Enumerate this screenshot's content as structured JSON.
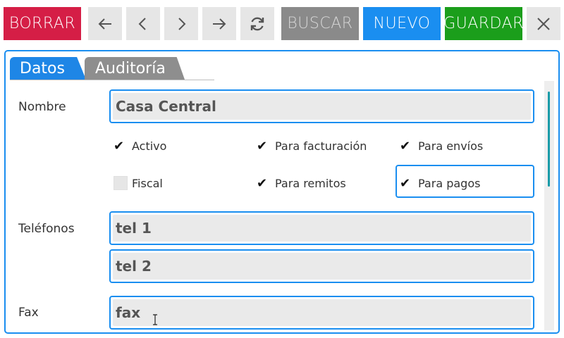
{
  "toolbar": {
    "borrar_label": "BORRAR",
    "buscar_label": "BUSCAR",
    "nuevo_label": "NUEVO",
    "guardar_label": "GUARDAR",
    "icons": [
      "arrow-left-icon",
      "chevron-left-icon",
      "chevron-right-icon",
      "arrow-right-icon",
      "refresh-icon",
      "close-icon"
    ],
    "colors": {
      "borrar": "#d51e46",
      "buscar": "#8a8a8a",
      "nuevo": "#1a8ef0",
      "guardar": "#1b9e1b"
    }
  },
  "tabs": [
    {
      "label": "Datos",
      "active": true
    },
    {
      "label": "Auditoría",
      "active": false
    }
  ],
  "form": {
    "nombre_label": "Nombre",
    "nombre_value": "Casa Central",
    "checks": [
      {
        "label": "Activo",
        "checked": true
      },
      {
        "label": "Para facturación",
        "checked": true
      },
      {
        "label": "Para envíos",
        "checked": true
      },
      {
        "label": "Fiscal",
        "checked": false
      },
      {
        "label": "Para remitos",
        "checked": true
      },
      {
        "label": "Para pagos",
        "checked": true
      }
    ],
    "telefonos_label": "Teléfonos",
    "tel1_value": "tel 1",
    "tel2_value": "tel 2",
    "fax_label": "Fax",
    "fax_value": "fax"
  },
  "accent_color": "#1a8ef0"
}
